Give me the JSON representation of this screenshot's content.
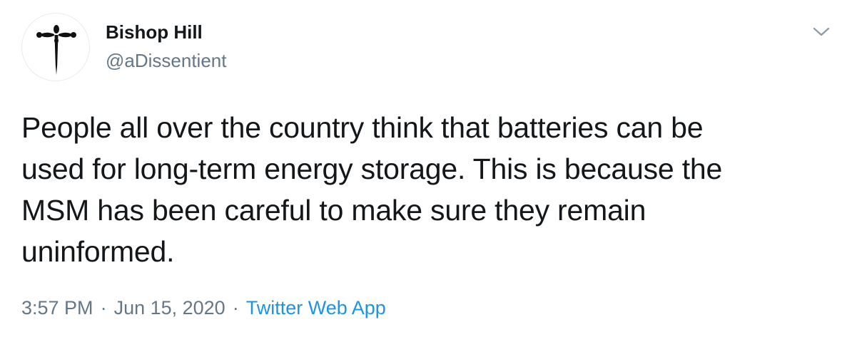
{
  "author": {
    "display_name": "Bishop Hill",
    "handle": "@aDissentient",
    "avatar_icon": "cross-icon"
  },
  "tweet": {
    "text": "People all over the country think that batteries can be\nused for long-term energy storage. This is because the\nMSM has been careful to make sure they remain\nuninformed."
  },
  "meta": {
    "time": "3:57 PM",
    "separator": "·",
    "date": "Jun 15, 2020",
    "source": "Twitter Web App"
  },
  "menu": {
    "icon": "chevron-down-icon"
  },
  "colors": {
    "text": "#14171a",
    "secondary": "#657786",
    "link": "#1b95e0",
    "caret": "#8899a6"
  }
}
